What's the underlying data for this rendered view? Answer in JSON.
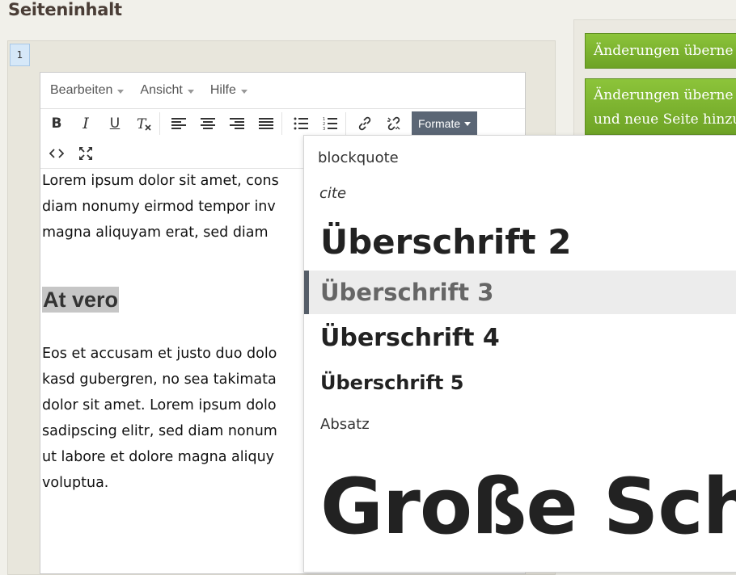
{
  "page": {
    "title": "Seiteninhalt",
    "row_number": "1"
  },
  "editor": {
    "menubar": [
      {
        "label": "Bearbeiten"
      },
      {
        "label": "Ansicht"
      },
      {
        "label": "Hilfe"
      }
    ],
    "toolbar": {
      "bold": "B",
      "italic": "I",
      "underline": "U",
      "formats_label": "Formate"
    },
    "content": {
      "paragraph1_lines": [
        "Lorem ipsum dolor sit amet, cons",
        "diam nonumy eirmod tempor inv",
        "magna aliquyam erat, sed diam"
      ],
      "heading": "At vero",
      "paragraph2_lines": [
        "Eos et accusam et justo duo dolo",
        "kasd gubergren, no sea takimata",
        "dolor sit amet. Lorem ipsum dolo",
        "sadipscing elitr, sed diam nonum",
        "ut labore et dolore magna aliquy",
        "voluptua."
      ]
    }
  },
  "sidebar": {
    "apply_button": "Änderungen überne",
    "apply_and_add_line1": "Änderungen überne",
    "apply_and_add_line2": "und neue Seite hinzu"
  },
  "formats_dropdown": {
    "items": [
      {
        "label": "blockquote"
      },
      {
        "label": "cite"
      },
      {
        "label": "Überschrift 2"
      },
      {
        "label": "Überschrift 3",
        "selected": true
      },
      {
        "label": "Überschrift 4"
      },
      {
        "label": "Überschrift 5"
      },
      {
        "label": "Absatz"
      },
      {
        "label": "Große Schr"
      }
    ]
  },
  "colors": {
    "accent_green": "#7cb32e",
    "formats_button": "#5b6675",
    "selected_border": "#555e69"
  }
}
